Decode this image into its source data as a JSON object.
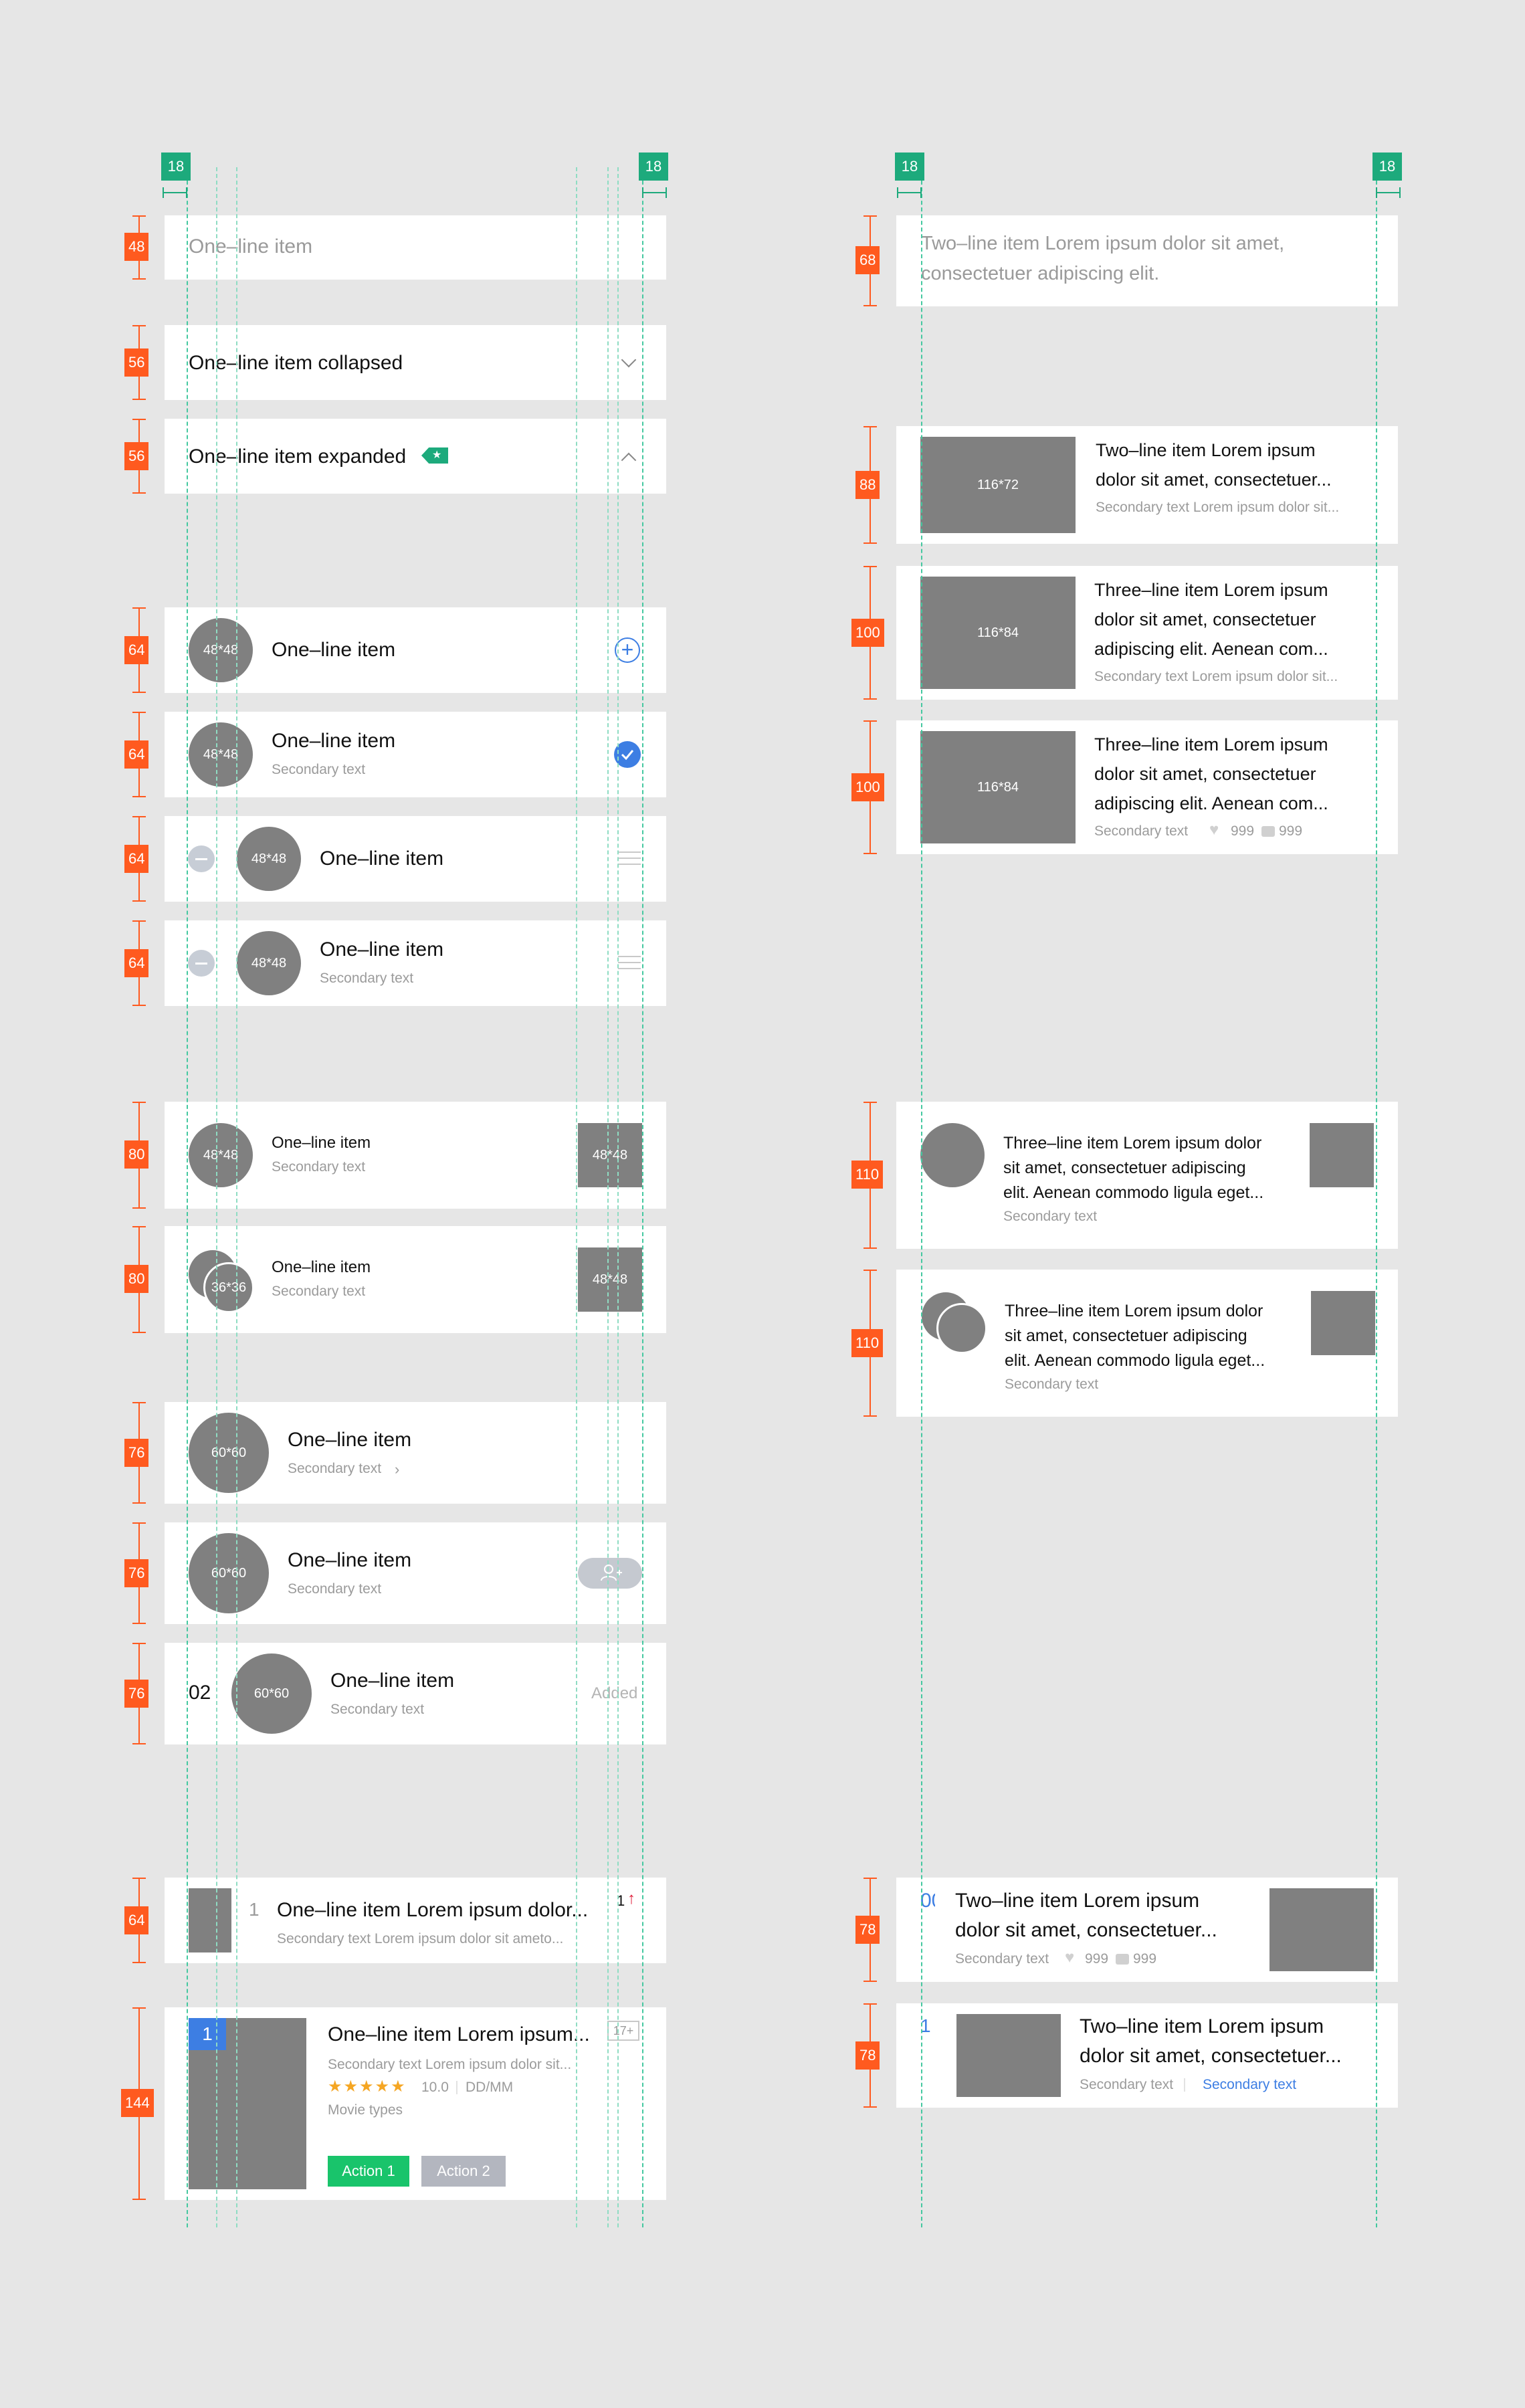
{
  "guides": {
    "margin_left": "18",
    "margin_right": "18",
    "right_margin_left": "18",
    "right_margin_right": "18"
  },
  "heights": {
    "h48": "48",
    "h56a": "56",
    "h56b": "56",
    "h64a": "64",
    "h64b": "64",
    "h64c": "64",
    "h64d": "64",
    "h80a": "80",
    "h80b": "80",
    "h76a": "76",
    "h76b": "76",
    "h76c": "76",
    "h64e": "64",
    "h144": "144",
    "h68": "68",
    "h88": "88",
    "h100a": "100",
    "h100b": "100",
    "h110a": "110",
    "h110b": "110",
    "h78a": "78",
    "h78b": "78"
  },
  "colors": {
    "accent_blue": "#3d7ee3",
    "brand_green": "#1daa7c",
    "action_green": "#19c46b",
    "measure_orange": "#ff5a1f",
    "star": "#f5a623",
    "placeholder": "#808080"
  },
  "left": {
    "r1": {
      "title": "One–line item"
    },
    "r2": {
      "title": "One–line item collapsed",
      "icon": "chevron-down-icon"
    },
    "r3": {
      "title": "One–line item expanded",
      "icon": "chevron-up-icon",
      "tag_icon": "tag-star-icon"
    },
    "r4": {
      "avatar": "48*48",
      "title": "One–line item",
      "icon": "add-circle-icon"
    },
    "r5": {
      "avatar": "48*48",
      "title": "One–line item",
      "sub": "Secondary text",
      "icon": "check-circle-icon"
    },
    "r6": {
      "avatar": "48*48",
      "title": "One–line item",
      "icon": "drag-handle-icon"
    },
    "r7": {
      "avatar": "48*48",
      "title": "One–line item",
      "sub": "Secondary text"
    },
    "r8": {
      "avatar": "48*48",
      "title": "One–line item",
      "sub": "Secondary text",
      "thumb": "48*48"
    },
    "r9": {
      "avatar": "36*36",
      "title": "One–line item",
      "sub": "Secondary text",
      "thumb": "48*48"
    },
    "r10": {
      "avatar": "60*60",
      "title": "One–line item",
      "sub": "Secondary text",
      "sub_icon": "chevron-right-icon"
    },
    "r11": {
      "avatar": "60*60",
      "title": "One–line item",
      "sub": "Secondary text",
      "icon": "add-user-icon"
    },
    "r12": {
      "rank": "02",
      "avatar": "60*60",
      "title": "One–line item",
      "sub": "Secondary text",
      "status": "Added"
    },
    "r13": {
      "rank": "1",
      "title": "One–line item Lorem ipsum dolor...",
      "sub": "Secondary text Lorem ipsum dolor sit ameto...",
      "trend": "1",
      "trend_icon": "arrow-up-icon"
    },
    "r14": {
      "badge": "1",
      "title": "One–line item Lorem ipsum...",
      "sub": "Secondary text Lorem ipsum dolor sit...",
      "rating": "10.0",
      "date": "DD/MM",
      "types": "Movie types",
      "age": "17+",
      "action1": "Action 1",
      "action2": "Action 2"
    }
  },
  "right": {
    "r1": {
      "title": "Two–line item Lorem ipsum dolor sit amet, consectetuer adipiscing elit."
    },
    "r2": {
      "thumb": "116*72",
      "title1": "Two–line item Lorem ipsum",
      "title2": "dolor sit amet, consectetuer...",
      "sub": "Secondary text Lorem ipsum dolor sit..."
    },
    "r3": {
      "thumb": "116*84",
      "title1": "Three–line item Lorem ipsum",
      "title2": "dolor sit amet, consectetuer",
      "title3": "adipiscing elit. Aenean com...",
      "sub": "Secondary text Lorem ipsum dolor sit..."
    },
    "r4": {
      "thumb": "116*84",
      "title1": "Three–line item Lorem ipsum",
      "title2": "dolor sit amet, consectetuer",
      "title3": "adipiscing elit. Aenean com...",
      "sub": "Secondary text",
      "likes": "999",
      "comments": "999"
    },
    "r5": {
      "title1": "Three–line item Lorem ipsum dolor",
      "title2": "sit amet, consectetuer adipiscing",
      "title3": "elit. Aenean commodo ligula eget...",
      "sub": "Secondary text"
    },
    "r6": {
      "title1": "Three–line item Lorem ipsum dolor",
      "title2": "sit amet, consectetuer adipiscing",
      "title3": "elit. Aenean commodo ligula eget...",
      "sub": "Secondary text"
    },
    "r7": {
      "rank": "00",
      "title1": "Two–line item Lorem ipsum",
      "title2": "dolor sit amet, consectetuer...",
      "sub": "Secondary text",
      "likes": "999",
      "comments": "999"
    },
    "r8": {
      "rank": "1",
      "title1": "Two–line item Lorem ipsum",
      "title2": "dolor sit amet, consectetuer...",
      "sub": "Secondary text",
      "link": "Secondary text"
    }
  }
}
